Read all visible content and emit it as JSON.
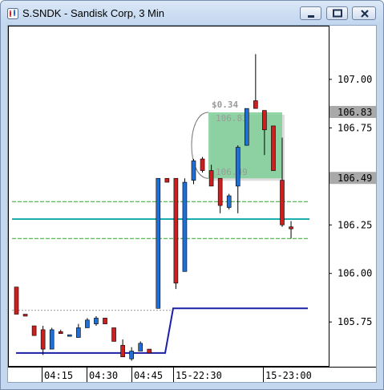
{
  "window": {
    "title": "S.SNDK - Sandisk Corp, 3 Min",
    "minimize_icon": "minimize-icon",
    "maximize_icon": "maximize-icon",
    "close_icon": "close-icon"
  },
  "chart_data": {
    "type": "candlestick",
    "symbol": "S.SNDK",
    "title": "S.SNDK - Sandisk Corp, 3 Min",
    "ylim": [
      105.54,
      107.26
    ],
    "y_ticks": [
      "107.00",
      "106.75",
      "106.50",
      "106.25",
      "106.00",
      "105.75"
    ],
    "price_labels": {
      "upper": "106.83",
      "lower": "106.49"
    },
    "x_labels": [
      "04:15",
      "04:30",
      "04:45",
      "15-22:30",
      "15-23:00"
    ],
    "candles": [
      {
        "o": 105.93,
        "h": 105.93,
        "l": 105.79,
        "c": 105.79
      },
      {
        "o": 105.79,
        "h": 105.79,
        "l": 105.78,
        "c": 105.78
      },
      {
        "o": 105.73,
        "h": 105.73,
        "l": 105.68,
        "c": 105.68
      },
      {
        "o": 105.71,
        "h": 105.73,
        "l": 105.58,
        "c": 105.61
      },
      {
        "o": 105.61,
        "h": 105.72,
        "l": 105.61,
        "c": 105.71
      },
      {
        "o": 105.7,
        "h": 105.71,
        "l": 105.69,
        "c": 105.69
      },
      {
        "o": 105.68,
        "h": 105.68,
        "l": 105.68,
        "c": 105.68
      },
      {
        "o": 105.67,
        "h": 105.74,
        "l": 105.67,
        "c": 105.72
      },
      {
        "o": 105.72,
        "h": 105.77,
        "l": 105.72,
        "c": 105.76
      },
      {
        "o": 105.74,
        "h": 105.78,
        "l": 105.73,
        "c": 105.77
      },
      {
        "o": 105.77,
        "h": 105.77,
        "l": 105.74,
        "c": 105.74
      },
      {
        "o": 105.72,
        "h": 105.72,
        "l": 105.65,
        "c": 105.65
      },
      {
        "o": 105.63,
        "h": 105.66,
        "l": 105.57,
        "c": 105.57
      },
      {
        "o": 105.56,
        "h": 105.62,
        "l": 105.55,
        "c": 105.6
      },
      {
        "o": 105.6,
        "h": 105.65,
        "l": 105.6,
        "c": 105.64
      },
      {
        "o": 105.61,
        "h": 105.61,
        "l": 105.59,
        "c": 105.59
      },
      {
        "o": 105.82,
        "h": 106.49,
        "l": 105.82,
        "c": 106.49
      },
      {
        "o": 106.49,
        "h": 106.49,
        "l": 106.47,
        "c": 106.47
      },
      {
        "o": 106.49,
        "h": 106.49,
        "l": 105.92,
        "c": 105.95
      },
      {
        "o": 106.01,
        "h": 106.49,
        "l": 106.01,
        "c": 106.47
      },
      {
        "o": 106.48,
        "h": 106.59,
        "l": 106.46,
        "c": 106.58
      },
      {
        "o": 106.59,
        "h": 106.6,
        "l": 106.52,
        "c": 106.53
      },
      {
        "o": 106.53,
        "h": 106.56,
        "l": 106.45,
        "c": 106.45
      },
      {
        "o": 106.49,
        "h": 106.49,
        "l": 106.31,
        "c": 106.35
      },
      {
        "o": 106.34,
        "h": 106.41,
        "l": 106.33,
        "c": 106.4
      },
      {
        "o": 106.45,
        "h": 106.66,
        "l": 106.31,
        "c": 106.65
      },
      {
        "o": 106.66,
        "h": 106.85,
        "l": 106.66,
        "c": 106.85
      },
      {
        "o": 106.89,
        "h": 107.13,
        "l": 106.85,
        "c": 106.85
      },
      {
        "o": 106.84,
        "h": 106.84,
        "l": 106.61,
        "c": 106.74
      },
      {
        "o": 106.76,
        "h": 106.76,
        "l": 106.55,
        "c": 106.53
      },
      {
        "o": 106.48,
        "h": 106.7,
        "l": 106.24,
        "c": 106.25
      },
      {
        "o": 106.24,
        "h": 106.27,
        "l": 106.18,
        "c": 106.23
      }
    ],
    "lines": {
      "green_upper": 106.37,
      "teal": 106.28,
      "green_lower": 106.18,
      "dotted_gray": 105.81
    },
    "navy_step": {
      "level_low": 105.59,
      "level_high": 105.82
    },
    "measure_box": {
      "label": "$0.34",
      "top_value": "106.83",
      "bottom_value": "106.49",
      "top": 106.83,
      "bottom": 106.49
    },
    "colors": {
      "up": "#1f6fd6",
      "down": "#cc1f1f",
      "green_line": "#28a828",
      "teal_line": "#1aaeb0",
      "navy_line": "#1c1fa8",
      "measure_fill": "#7fcf98"
    },
    "grid": false
  }
}
